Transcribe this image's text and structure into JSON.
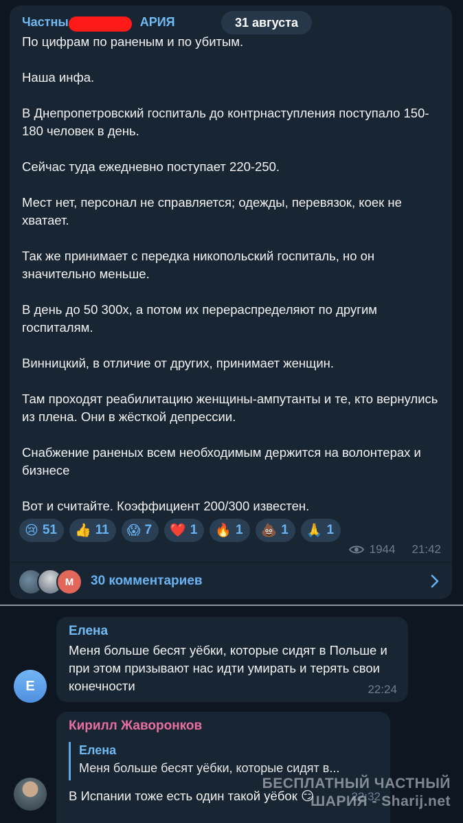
{
  "post": {
    "channel_name_left": "Частны",
    "channel_name_right": "АРИЯ",
    "date": "31 августа",
    "paragraphs": [
      "По цифрам по раненым и по убитым.",
      "Наша инфа.",
      "В Днепропетровский госпиталь до контрнаступления поступало 150-180 человек в день.",
      "Сейчас туда ежедневно поступает 220-250.",
      "Мест нет, персонал не справляется; одежды, перевязок, коек не хватает.",
      "Так же принимает с передка никопольский госпиталь, но он значительно меньше.",
      "В день до 50 300х, а потом их перераспределяют по другим госпиталям.",
      "Винницкий, в отличие от других, принимает женщин.",
      "Там проходят реабилитацию женщины-ампутанты и те, кто вернулись из плена. Они в жёсткой депрессии.",
      "Снабжение раненых всем необходимым держится на волонтерах и бизнесе",
      "Вот и считайте. Коэффициент 200/300 известен."
    ],
    "reactions": [
      {
        "emoji": "😢",
        "count": "51"
      },
      {
        "emoji": "👍",
        "count": "11"
      },
      {
        "emoji": "😱",
        "count": "7"
      },
      {
        "emoji": "❤️",
        "count": "1"
      },
      {
        "emoji": "🔥",
        "count": "1"
      },
      {
        "emoji": "💩",
        "count": "1"
      },
      {
        "emoji": "🙏",
        "count": "1"
      }
    ],
    "views": "1944",
    "time": "21:42",
    "comments_label": "30 комментариев",
    "commenter_avatar_letter": "М"
  },
  "comments": [
    {
      "author": "Елена",
      "author_color": "#71baf4",
      "avatar_letter": "Е",
      "text": "Меня больше бесят уёбки, которые сидят в Польше и при этом призывают нас идти умирать и терять свои конечности",
      "time": "22:24"
    },
    {
      "author": "Кирилл Жаворонков",
      "author_color": "#e66fa0",
      "reply_author": "Елена",
      "reply_text": "Меня больше бесят уёбки, которые сидят в...",
      "text": "В Испании тоже есть один такой уёбок 😏",
      "time": "22:32"
    }
  ],
  "watermark": {
    "line1": "БЕСПЛАТНЫЙ ЧАСТНЫЙ",
    "line2": "ШАРИЯ - Sharij.net"
  }
}
